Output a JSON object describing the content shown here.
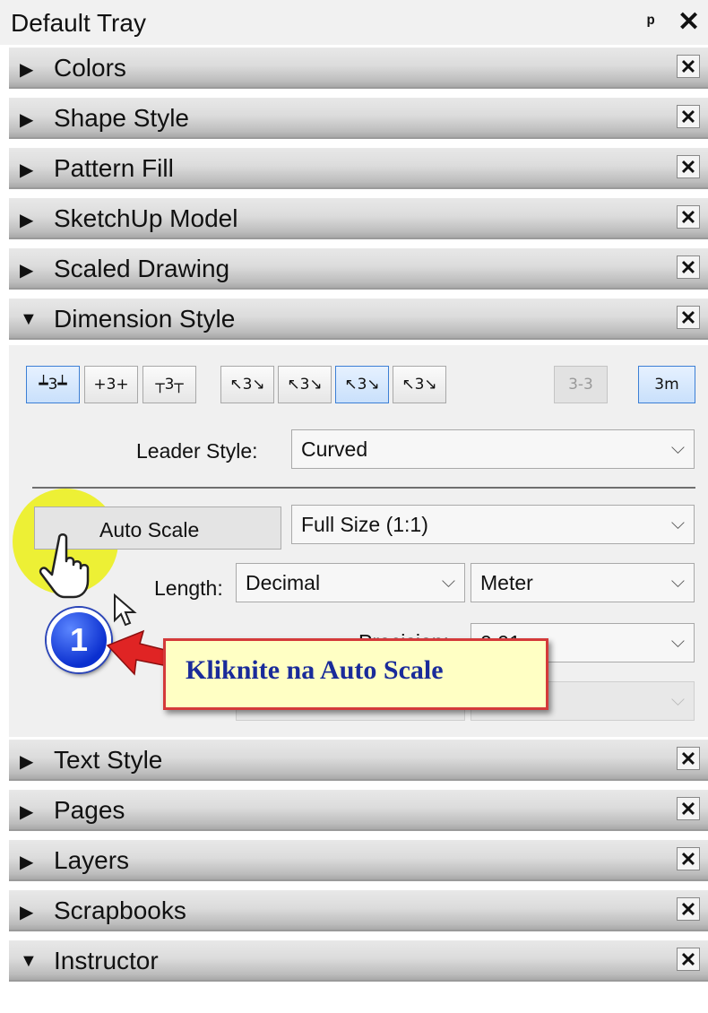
{
  "tray": {
    "title": "Default Tray",
    "pin_glyph": "ᵖ",
    "close_glyph": "✕"
  },
  "panels": {
    "colors": {
      "label": "Colors",
      "arrow": "▶",
      "close": "✕"
    },
    "shape_style": {
      "label": "Shape Style",
      "arrow": "▶",
      "close": "✕"
    },
    "pattern_fill": {
      "label": "Pattern Fill",
      "arrow": "▶",
      "close": "✕"
    },
    "sketchup_model": {
      "label": "SketchUp Model",
      "arrow": "▶",
      "close": "✕"
    },
    "scaled_drawing": {
      "label": "Scaled Drawing",
      "arrow": "▶",
      "close": "✕"
    },
    "dimension_style": {
      "label": "Dimension Style",
      "arrow": "▼",
      "close": "✕"
    },
    "text_style": {
      "label": "Text Style",
      "arrow": "▶",
      "close": "✕"
    },
    "pages": {
      "label": "Pages",
      "arrow": "▶",
      "close": "✕"
    },
    "layers": {
      "label": "Layers",
      "arrow": "▶",
      "close": "✕"
    },
    "scrapbooks": {
      "label": "Scrapbooks",
      "arrow": "▶",
      "close": "✕"
    },
    "instructor": {
      "label": "Instructor",
      "arrow": "▼",
      "close": "✕"
    }
  },
  "dimension": {
    "text_position_buttons": [
      "┷3┷",
      "+3+",
      "┬3┬"
    ],
    "leader_buttons": [
      "↖3↘",
      "↖3↘",
      "↖3↘",
      "↖3↘"
    ],
    "unit_buttons": [
      "3-3",
      "3m"
    ],
    "leader_style_label": "Leader Style:",
    "leader_style_value": "Curved",
    "auto_scale_label": "Auto Scale",
    "scale_value": "Full Size (1:1)",
    "length_label": "Length:",
    "length_format": "Decimal",
    "length_unit": "Meter",
    "precision_label": "Precision:",
    "precision_value": "0.01",
    "chevron": "⌵"
  },
  "annotation": {
    "step_number": "1",
    "callout_text": "Kliknite na Auto Scale",
    "highlight_color": "#ecf014",
    "callout_border": "#d43a3a",
    "badge_color": "#0b2fcf"
  }
}
